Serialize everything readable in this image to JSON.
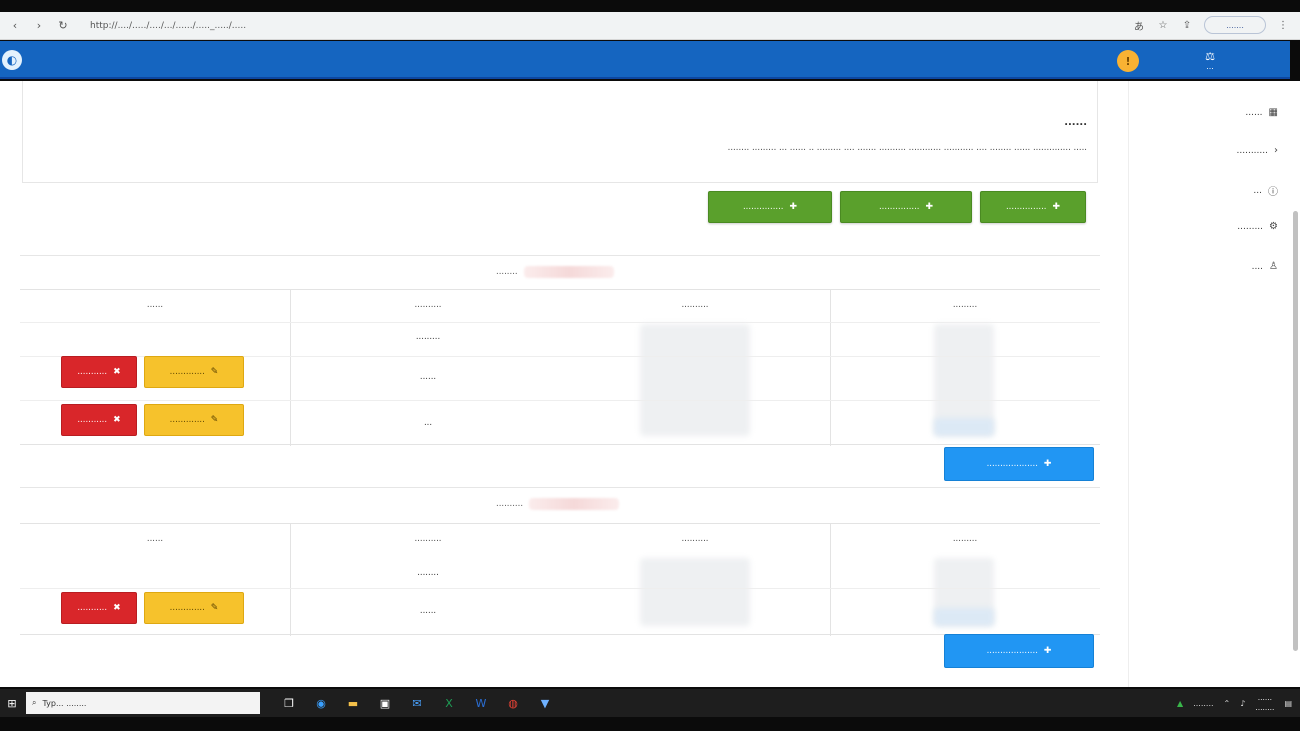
{
  "browser": {
    "address": "http://..../...../..../.../....../....._...../.....",
    "profile_label": "......."
  },
  "header": {
    "logo_mark": "⚖",
    "logo_text": "..."
  },
  "sidebar": {
    "items": [
      {
        "label": "......",
        "icon": "grid-icon",
        "glyph": "▦"
      },
      {
        "label": "...........",
        "icon": "chevron-left-icon",
        "glyph": "‹"
      },
      {
        "label": "...",
        "icon": "info-icon",
        "glyph": "ⓘ"
      },
      {
        "label": ".........",
        "icon": "settings-icon",
        "glyph": "⚙"
      },
      {
        "label": "....",
        "icon": "user-icon",
        "glyph": "♙"
      }
    ]
  },
  "note": {
    "title": "......",
    "text": "..... .............. ...... ........ .... ........... ............ .......... ....... .... ......... .. ...... ... ......... ........"
  },
  "actions": {
    "btn1": "...............",
    "btn2": "...............",
    "btn3": "..............."
  },
  "section1": {
    "title": "........",
    "headers": {
      "c1": ".........",
      "c2": "..........",
      "c3": "..........",
      "c4": "......"
    },
    "rows": [
      {
        "c2": ".........",
        "c3": ""
      },
      {
        "c2": "......",
        "c3": "",
        "edit": ".............",
        "delete": "..........."
      },
      {
        "c2": "...",
        "c3": "",
        "edit": ".............",
        "delete": "..........."
      }
    ],
    "add_button": "..................."
  },
  "section2": {
    "title": "..........",
    "headers": {
      "c1": ".........",
      "c2": "..........",
      "c3": "..........",
      "c4": "......"
    },
    "rows": [
      {
        "c2": "........",
        "c3": ""
      },
      {
        "c2": "......",
        "c3": "",
        "edit": ".............",
        "delete": "..........."
      }
    ],
    "add_button": "..................."
  },
  "taskbar": {
    "search_placeholder": "Typ... ........",
    "tray_text": "........",
    "time": "......",
    "date": "........"
  },
  "colors": {
    "appbar": "#1565c0",
    "green": "#5aa02c",
    "yellow": "#f6c22c",
    "red": "#d9262a",
    "blue": "#2196f3"
  }
}
